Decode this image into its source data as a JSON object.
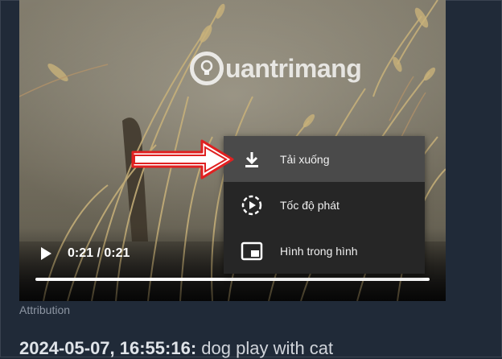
{
  "video": {
    "watermark_text": "uantrimang",
    "time_display": "0:21 / 0:21",
    "progress_fraction": 1.0,
    "play_icon": "play-icon"
  },
  "context_menu": {
    "items": [
      {
        "label": "Tải xuống",
        "icon": "download-icon"
      },
      {
        "label": "Tốc độ phát",
        "icon": "playback-speed-icon"
      },
      {
        "label": "Hình trong hình",
        "icon": "picture-in-picture-icon"
      }
    ]
  },
  "attribution": "Attribution",
  "caption": {
    "timestamp": "2024-05-07, 16:55:16:",
    "text": "dog play with cat"
  },
  "colors": {
    "page_bg": "#202a38",
    "menu_bg": "#262626",
    "menu_highlight": "#4a4a4a",
    "arrow": "#e02020"
  }
}
